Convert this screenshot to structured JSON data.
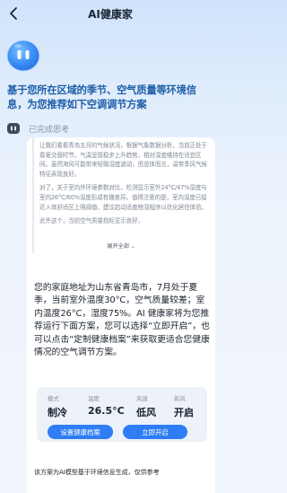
{
  "header": {
    "title": "AI健康家"
  },
  "headline": "基于您所在区域的季节、空气质量等环境信息，为您推荐如下空调调节方案",
  "thinking": {
    "status": "已完成思考",
    "paragraphs": [
      "让我们看看青岛五月的气候状况，根据气象数据分析，当前正处于春夏交替时节，气温呈现稳步上升趋势，相对湿度维持在适宜区间。虽然海风可能带来轻微湿度波动，但总体而言，温带季风气候特征表现良好。",
      "对了，关于室内外环境参数对比，检测显示室外24°C/47%湿度与室内26°C/60%湿度形成有趣差异。值得注意的是，室内湿度已接近人体舒适区上限阈值，建议启动适度除湿程序以优化居住体验。",
      "此外这个，当前空气质量指标显示良好，"
    ],
    "expand_label": "展开全部"
  },
  "answer": "您的家庭地址为山东省青岛市，7月处于夏季，当前室外温度30°C，空气质量较差；室内温度26°C，湿度75%。AI 健康家将为您推荐运行下面方案，您可以选择“立即开启”，也可以点击“定制健康档案”来获取更适合您健康情况的空气调节方案。",
  "settings": {
    "mode": {
      "label": "模式",
      "value": "制冷"
    },
    "temperature": {
      "label": "温度",
      "value": "26.5°C"
    },
    "fan_speed": {
      "label": "风速",
      "value": "低风"
    },
    "fresh_air": {
      "label": "新风",
      "value": "开启"
    }
  },
  "buttons": {
    "profile": "设置健康档案",
    "start": "立即开启"
  },
  "disclaimer": "该方案为AI模型基于环境信息生成，仅供参考",
  "colors": {
    "accent": "#2f7df6",
    "headline": "#1f5fa8",
    "mascot": "#3a8ef6"
  },
  "icons": {
    "back": "chevron-left-icon",
    "mascot": "robot-mascot-icon",
    "bot": "robot-icon",
    "expand": "chevron-down-icon"
  }
}
